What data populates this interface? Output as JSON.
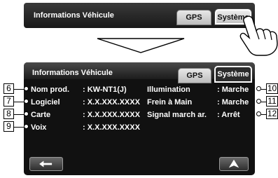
{
  "top_screen": {
    "title": "Informations Véhicule",
    "tabs": [
      {
        "label": "GPS",
        "active": false
      },
      {
        "label": "Système",
        "active": true
      }
    ]
  },
  "main_screen": {
    "title": "Informations Véhicule",
    "tabs": [
      {
        "label": "GPS",
        "active": false
      },
      {
        "label": "Système",
        "active": true
      }
    ],
    "left_rows": [
      {
        "callout": "6",
        "label": "Nom prod.",
        "value": ": KW-NT1(J)"
      },
      {
        "callout": "7",
        "label": "Logiciel",
        "value": ": X.X.XXX.XXXX"
      },
      {
        "callout": "8",
        "label": "Carte",
        "value": ": X.X.XXX.XXXX"
      },
      {
        "callout": "9",
        "label": "Voix",
        "value": ": X.X.XXX.XXXX"
      }
    ],
    "right_rows": [
      {
        "callout": "10",
        "label": "Illumination",
        "value": ": Marche"
      },
      {
        "callout": "11",
        "label": "Frein à Main",
        "value": ": Marche"
      },
      {
        "callout": "12",
        "label": "Signal march ar.",
        "value": ": Arrêt"
      }
    ],
    "buttons": {
      "back_icon": "return-arrow-icon",
      "next_icon": "navigation-arrow-icon"
    }
  },
  "colors": {
    "screen_bg": "#111111",
    "header_bg": "#2a2a2a",
    "text": "#ffffff",
    "tab_inactive": "#d8d8d8"
  }
}
